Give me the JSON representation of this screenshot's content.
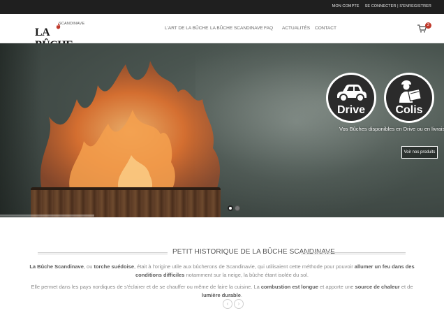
{
  "topbar": {
    "account": "MON COMPTE",
    "login": "SE CONNECTER | S'ENREGISTRER"
  },
  "logo": {
    "small": "SCANDINAVE",
    "word_la": "LA ",
    "word_buche": "BÛCHE"
  },
  "nav": {
    "items": [
      "L'ART DE LA BÛCHE",
      "LA BÛCHE SCANDINAVE",
      "FAQ",
      "ACTUALITÉS",
      "CONTACT"
    ]
  },
  "cart": {
    "count": "2",
    "icon": "cart-icon"
  },
  "hero": {
    "drive_label": "Drive",
    "colis_label": "Colis",
    "tagline": "Vos Bûches disponibles en Drive ou en livraison !",
    "cta_label": "Voir nos produits",
    "slide_count": 2,
    "active_slide": 1
  },
  "section": {
    "title": "PETIT HISTORIQUE DE LA BÛCHE SCANDINAVE",
    "p1_a": "La Bûche Scandinave",
    "p1_b": ", ou ",
    "p1_c": "torche suédoise",
    "p1_d": ", était à l'origine utile aux bûcherons de Scandinavie, qui utilisaient cette méthode pour pouvoir ",
    "p1_e": "allumer un feu dans des conditions difficiles",
    "p1_f": " notamment sur la neige, la bûche étant isolée du sol.",
    "p2_a": "Elle permet dans les pays nordiques de s'éclairer et de se chauffer ou même de faire la cuisine. La ",
    "p2_b": "combustion est longue",
    "p2_c": " et apporte une ",
    "p2_d": "source de chaleur",
    "p2_e": " et de ",
    "p2_f": "lumière durable",
    "p2_g": "."
  },
  "arrows": {
    "prev": "‹",
    "next": "›"
  },
  "colors": {
    "topbar": "#1f1f1f",
    "badge": "#c0392b",
    "text_muted": "#8a8a8a"
  }
}
